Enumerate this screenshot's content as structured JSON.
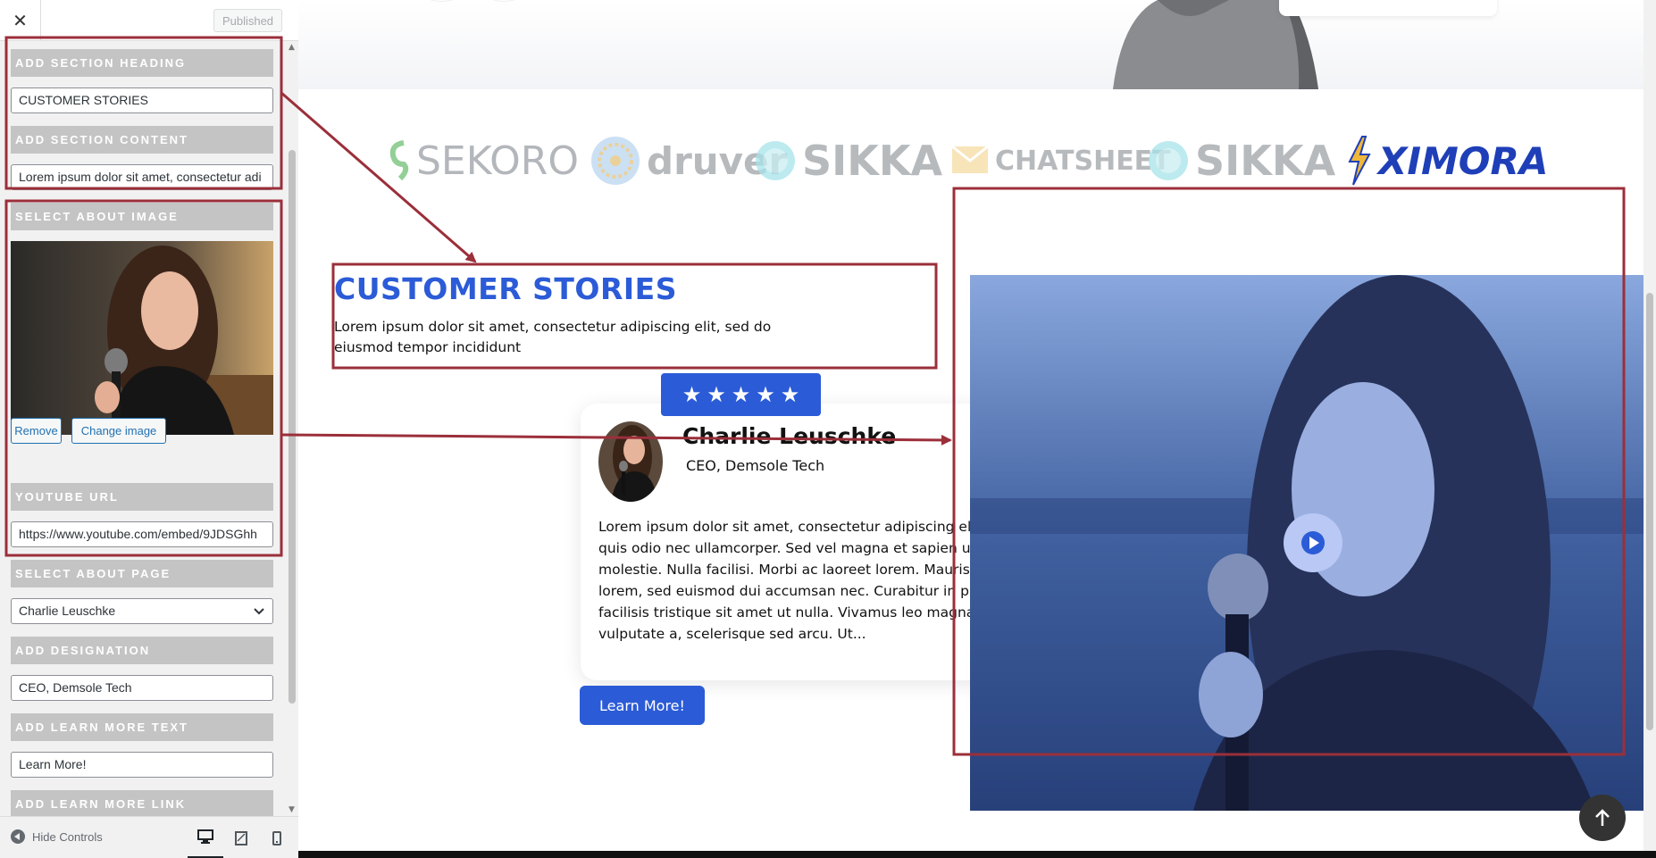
{
  "customizer": {
    "close_icon": "close-icon",
    "published_label": "Published",
    "controls": [
      {
        "heading": "ADD SECTION HEADING",
        "value": "CUSTOMER STORIES"
      },
      {
        "heading": "ADD SECTION CONTENT",
        "value": "Lorem ipsum dolor sit amet, consectetur adi"
      },
      {
        "heading": "SELECT ABOUT IMAGE"
      },
      {
        "heading": "YOUTUBE URL",
        "value": "https://www.youtube.com/embed/9JDSGhh"
      },
      {
        "heading": "SELECT ABOUT PAGE",
        "value": "Charlie Leuschke"
      },
      {
        "heading": "ADD DESIGNATION",
        "value": "CEO, Demsole Tech"
      },
      {
        "heading": "ADD LEARN MORE TEXT",
        "value": "Learn More!"
      },
      {
        "heading": "ADD LEARN MORE LINK"
      }
    ],
    "remove_label": "Remove",
    "change_image_label": "Change image",
    "hide_controls_label": "Hide Controls",
    "devices": [
      "desktop-icon",
      "tablet-icon",
      "mobile-icon"
    ]
  },
  "preview": {
    "logos": [
      "SEKORO",
      "druver",
      "SIKKA",
      "CHATSHEET",
      "SIKKA",
      "XIMORA"
    ],
    "section_title": "CUSTOMER STORIES",
    "section_content": "Lorem ipsum dolor sit amet, consectetur adipiscing elit, sed do eiusmod tempor incididunt",
    "stars": 5,
    "testimonial": {
      "name": "Charlie Leuschke",
      "designation": "CEO, Demsole Tech",
      "body": "Lorem ipsum dolor sit amet, consectetur adipiscing elit. Duis eleifend quis odio nec ullamcorper. Sed vel magna et sapien ullamcorper molestie. Nulla facilisi. Morbi ac laoreet lorem. Mauris feugiat erat lorem, sed euismod dui accumsan nec. Curabitur in purus eu leo facilisis tristique sit amet ut nulla. Vivamus leo magna, viverra rutrum vulputate a, scelerisque sed arcu. Ut..."
    },
    "learn_more_label": "Learn More!",
    "play_icon": "play-icon",
    "back_to_top_icon": "arrow-up-icon"
  },
  "colors": {
    "brand_blue": "#2b5bd7",
    "annotation_red": "#9b2f3a",
    "control_heading_bg": "#c4c4c4",
    "wp_link": "#2271b1"
  }
}
